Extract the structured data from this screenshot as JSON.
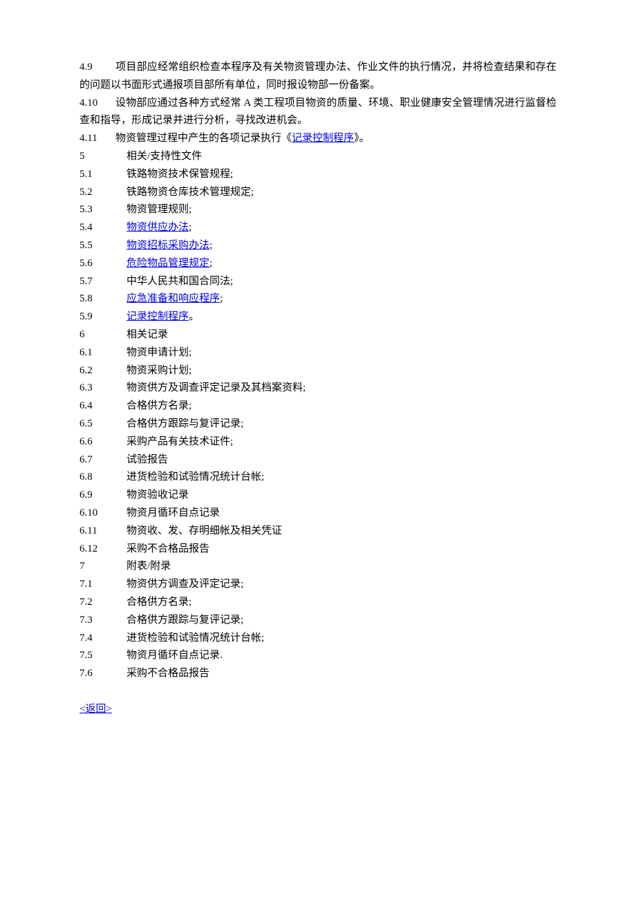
{
  "paragraphs": {
    "p49": {
      "num": "4.9",
      "text_before": "项目部应经常组织检查本程序及有关物资管理办法、作业文件的执行情况，并将检查结果和存在的问题以书面形式通报项目部所有单位，同时报设物部一份备案。"
    },
    "p410": {
      "num": "4.10",
      "text_before": "设物部应通过各种方式经常 A 类工程项目物资的质量、环境、职业健康安全管理情况进行监督检查和指导，形成记录并进行分析，寻找改进机会。"
    },
    "p411": {
      "num": "4.11",
      "text_before": "物资管理过程中产生的各项记录执行《",
      "link": "记录控制程序",
      "text_after": "》。"
    }
  },
  "sections": {
    "s5": {
      "num": "5",
      "title": "相关/支持性文件"
    },
    "s6": {
      "num": "6",
      "title": "相关记录"
    },
    "s7": {
      "num": "7",
      "title": "附表/附录"
    }
  },
  "items5": {
    "i1": {
      "num": "5.1",
      "text": "铁路物资技术保管规程;"
    },
    "i2": {
      "num": "5.2",
      "text": "铁路物资仓库技术管理规定;"
    },
    "i3": {
      "num": "5.3",
      "text": "物资管理规则;"
    },
    "i4": {
      "num": "5.4",
      "link": "物资供应办法",
      "suffix": ";"
    },
    "i5": {
      "num": "5.5",
      "link": "物资招标采购办法",
      "suffix": ";"
    },
    "i6": {
      "num": "5.6",
      "link": "危险物品管理规定",
      "suffix": ";"
    },
    "i7": {
      "num": "5.7",
      "text": "中华人民共和国合同法;"
    },
    "i8": {
      "num": "5.8",
      "link": "应急准备和响应程序",
      "suffix": ";"
    },
    "i9": {
      "num": "5.9",
      "link": "记录控制程序",
      "suffix": "。"
    }
  },
  "items6": {
    "i1": {
      "num": "6.1",
      "text": "物资申请计划;"
    },
    "i2": {
      "num": "6.2",
      "text": "物资采购计划;"
    },
    "i3": {
      "num": "6.3",
      "text": "物资供方及调查评定记录及其档案资料;"
    },
    "i4": {
      "num": "6.4",
      "text": "合格供方名录;"
    },
    "i5": {
      "num": "6.5",
      "text": "合格供方跟踪与复评记录;"
    },
    "i6": {
      "num": "6.6",
      "text": "采购产品有关技术证件;"
    },
    "i7": {
      "num": "6.7",
      "text": "试验报告"
    },
    "i8": {
      "num": "6.8",
      "text": "进货检验和试验情况统计台帐;"
    },
    "i9": {
      "num": "6.9",
      "text": "物资验收记录"
    },
    "i10": {
      "num": "6.10",
      "text": "物资月循环自点记录"
    },
    "i11": {
      "num": "6.11",
      "text": "物资收、发、存明细帐及相关凭证"
    },
    "i12": {
      "num": "6.12",
      "text": "采购不合格品报告"
    }
  },
  "items7": {
    "i1": {
      "num": "7.1",
      "text": "物资供方调查及评定记录;"
    },
    "i2": {
      "num": "7.2",
      "text": "合格供方名录;"
    },
    "i3": {
      "num": "7.3",
      "text": "合格供方跟踪与复评记录;"
    },
    "i4": {
      "num": "7.4",
      "text": "进货检验和试验情况统计台帐;"
    },
    "i5": {
      "num": "7.5",
      "text": "物资月循环自点记录."
    },
    "i6": {
      "num": "7.6",
      "text": "采购不合格品报告"
    }
  },
  "back": "<返回>"
}
